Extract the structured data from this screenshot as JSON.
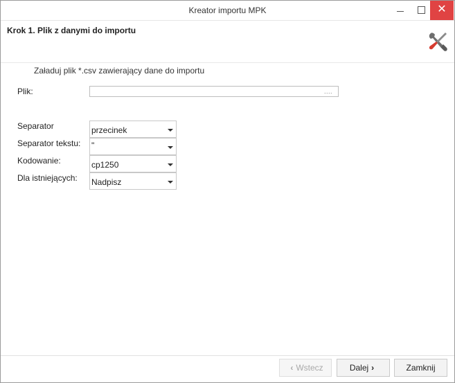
{
  "window": {
    "title": "Kreator importu MPK",
    "minimize_icon": "minimize-icon",
    "maximize_icon": "maximize-icon",
    "close_icon": "close-icon",
    "close_color": "#e04343"
  },
  "header": {
    "step_title": "Krok 1. Plik z danymi do importu",
    "icon": "tools-icon"
  },
  "form": {
    "instruction": "Załaduj plik *.csv zawierający dane do importu",
    "file": {
      "label": "Plik:",
      "value": "",
      "browse_label": "...."
    },
    "separator": {
      "label": "Separator",
      "value": "przecinek"
    },
    "text_separator": {
      "label": "Separator tekstu:",
      "value": "\""
    },
    "encoding": {
      "label": "Kodowanie:",
      "value": "cp1250"
    },
    "existing": {
      "label": "Dla istniejących:",
      "value": "Nadpisz"
    }
  },
  "footer": {
    "back_label": "Wstecz",
    "next_label": "Dalej",
    "close_label": "Zamknij"
  }
}
